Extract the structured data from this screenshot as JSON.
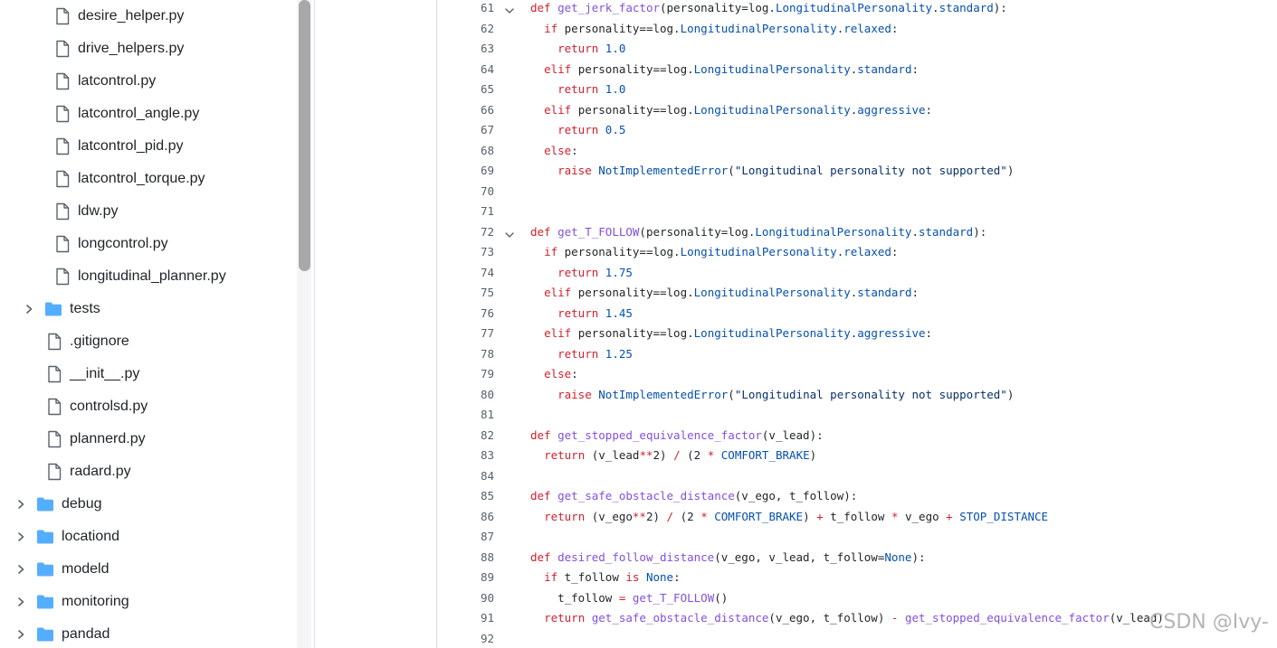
{
  "file_tree": {
    "items": [
      {
        "type": "file",
        "name": "desire_helper.py",
        "indent": 2
      },
      {
        "type": "file",
        "name": "drive_helpers.py",
        "indent": 2
      },
      {
        "type": "file",
        "name": "latcontrol.py",
        "indent": 2
      },
      {
        "type": "file",
        "name": "latcontrol_angle.py",
        "indent": 2
      },
      {
        "type": "file",
        "name": "latcontrol_pid.py",
        "indent": 2
      },
      {
        "type": "file",
        "name": "latcontrol_torque.py",
        "indent": 2
      },
      {
        "type": "file",
        "name": "ldw.py",
        "indent": 2
      },
      {
        "type": "file",
        "name": "longcontrol.py",
        "indent": 2
      },
      {
        "type": "file",
        "name": "longitudinal_planner.py",
        "indent": 2
      },
      {
        "type": "folder",
        "name": "tests",
        "indent": 1
      },
      {
        "type": "file",
        "name": ".gitignore",
        "indent": 1
      },
      {
        "type": "file",
        "name": "__init__.py",
        "indent": 1
      },
      {
        "type": "file",
        "name": "controlsd.py",
        "indent": 1
      },
      {
        "type": "file",
        "name": "plannerd.py",
        "indent": 1
      },
      {
        "type": "file",
        "name": "radard.py",
        "indent": 1
      },
      {
        "type": "folder",
        "name": "debug",
        "indent": 0
      },
      {
        "type": "folder",
        "name": "locationd",
        "indent": 0
      },
      {
        "type": "folder",
        "name": "modeld",
        "indent": 0
      },
      {
        "type": "folder",
        "name": "monitoring",
        "indent": 0
      },
      {
        "type": "folder",
        "name": "pandad",
        "indent": 0
      }
    ]
  },
  "code": {
    "lines": [
      {
        "n": "61",
        "fold": true,
        "tokens": [
          [
            "k",
            "def "
          ],
          [
            "f",
            "get_jerk_factor"
          ],
          [
            "p",
            "(personality=log."
          ],
          [
            "c",
            "LongitudinalPersonality"
          ],
          [
            "p",
            "."
          ],
          [
            "c",
            "standard"
          ],
          [
            "p",
            "):"
          ]
        ]
      },
      {
        "n": "62",
        "tokens": [
          [
            "p",
            "  "
          ],
          [
            "k",
            "if"
          ],
          [
            "p",
            " personality=="
          ],
          [
            "p",
            "log."
          ],
          [
            "c",
            "LongitudinalPersonality"
          ],
          [
            "p",
            "."
          ],
          [
            "c",
            "relaxed"
          ],
          [
            "p",
            ":"
          ]
        ]
      },
      {
        "n": "63",
        "tokens": [
          [
            "p",
            "    "
          ],
          [
            "k",
            "return"
          ],
          [
            "p",
            " "
          ],
          [
            "c",
            "1.0"
          ]
        ]
      },
      {
        "n": "64",
        "tokens": [
          [
            "p",
            "  "
          ],
          [
            "k",
            "elif"
          ],
          [
            "p",
            " personality=="
          ],
          [
            "p",
            "log."
          ],
          [
            "c",
            "LongitudinalPersonality"
          ],
          [
            "p",
            "."
          ],
          [
            "c",
            "standard"
          ],
          [
            "p",
            ":"
          ]
        ]
      },
      {
        "n": "65",
        "tokens": [
          [
            "p",
            "    "
          ],
          [
            "k",
            "return"
          ],
          [
            "p",
            " "
          ],
          [
            "c",
            "1.0"
          ]
        ]
      },
      {
        "n": "66",
        "tokens": [
          [
            "p",
            "  "
          ],
          [
            "k",
            "elif"
          ],
          [
            "p",
            " personality=="
          ],
          [
            "p",
            "log."
          ],
          [
            "c",
            "LongitudinalPersonality"
          ],
          [
            "p",
            "."
          ],
          [
            "c",
            "aggressive"
          ],
          [
            "p",
            ":"
          ]
        ]
      },
      {
        "n": "67",
        "tokens": [
          [
            "p",
            "    "
          ],
          [
            "k",
            "return"
          ],
          [
            "p",
            " "
          ],
          [
            "c",
            "0.5"
          ]
        ]
      },
      {
        "n": "68",
        "tokens": [
          [
            "p",
            "  "
          ],
          [
            "k",
            "else"
          ],
          [
            "p",
            ":"
          ]
        ]
      },
      {
        "n": "69",
        "tokens": [
          [
            "p",
            "    "
          ],
          [
            "k",
            "raise"
          ],
          [
            "p",
            " "
          ],
          [
            "c",
            "NotImplementedError"
          ],
          [
            "p",
            "("
          ],
          [
            "s",
            "\"Longitudinal personality not supported\""
          ],
          [
            "p",
            ")"
          ]
        ]
      },
      {
        "n": "70",
        "tokens": []
      },
      {
        "n": "71",
        "tokens": []
      },
      {
        "n": "72",
        "fold": true,
        "tokens": [
          [
            "k",
            "def "
          ],
          [
            "f",
            "get_T_FOLLOW"
          ],
          [
            "p",
            "(personality=log."
          ],
          [
            "c",
            "LongitudinalPersonality"
          ],
          [
            "p",
            "."
          ],
          [
            "c",
            "standard"
          ],
          [
            "p",
            "):"
          ]
        ]
      },
      {
        "n": "73",
        "tokens": [
          [
            "p",
            "  "
          ],
          [
            "k",
            "if"
          ],
          [
            "p",
            " personality=="
          ],
          [
            "p",
            "log."
          ],
          [
            "c",
            "LongitudinalPersonality"
          ],
          [
            "p",
            "."
          ],
          [
            "c",
            "relaxed"
          ],
          [
            "p",
            ":"
          ]
        ]
      },
      {
        "n": "74",
        "tokens": [
          [
            "p",
            "    "
          ],
          [
            "k",
            "return"
          ],
          [
            "p",
            " "
          ],
          [
            "c",
            "1.75"
          ]
        ]
      },
      {
        "n": "75",
        "tokens": [
          [
            "p",
            "  "
          ],
          [
            "k",
            "elif"
          ],
          [
            "p",
            " personality=="
          ],
          [
            "p",
            "log."
          ],
          [
            "c",
            "LongitudinalPersonality"
          ],
          [
            "p",
            "."
          ],
          [
            "c",
            "standard"
          ],
          [
            "p",
            ":"
          ]
        ]
      },
      {
        "n": "76",
        "tokens": [
          [
            "p",
            "    "
          ],
          [
            "k",
            "return"
          ],
          [
            "p",
            " "
          ],
          [
            "c",
            "1.45"
          ]
        ]
      },
      {
        "n": "77",
        "tokens": [
          [
            "p",
            "  "
          ],
          [
            "k",
            "elif"
          ],
          [
            "p",
            " personality=="
          ],
          [
            "p",
            "log."
          ],
          [
            "c",
            "LongitudinalPersonality"
          ],
          [
            "p",
            "."
          ],
          [
            "c",
            "aggressive"
          ],
          [
            "p",
            ":"
          ]
        ]
      },
      {
        "n": "78",
        "tokens": [
          [
            "p",
            "    "
          ],
          [
            "k",
            "return"
          ],
          [
            "p",
            " "
          ],
          [
            "c",
            "1.25"
          ]
        ]
      },
      {
        "n": "79",
        "tokens": [
          [
            "p",
            "  "
          ],
          [
            "k",
            "else"
          ],
          [
            "p",
            ":"
          ]
        ]
      },
      {
        "n": "80",
        "tokens": [
          [
            "p",
            "    "
          ],
          [
            "k",
            "raise"
          ],
          [
            "p",
            " "
          ],
          [
            "c",
            "NotImplementedError"
          ],
          [
            "p",
            "("
          ],
          [
            "s",
            "\"Longitudinal personality not supported\""
          ],
          [
            "p",
            ")"
          ]
        ]
      },
      {
        "n": "81",
        "tokens": []
      },
      {
        "n": "82",
        "tokens": [
          [
            "k",
            "def "
          ],
          [
            "f",
            "get_stopped_equivalence_factor"
          ],
          [
            "p",
            "(v_lead):"
          ]
        ]
      },
      {
        "n": "83",
        "tokens": [
          [
            "p",
            "  "
          ],
          [
            "k",
            "return"
          ],
          [
            "p",
            " (v_lead"
          ],
          [
            "k",
            "**"
          ],
          [
            "p",
            "2) "
          ],
          [
            "k",
            "/"
          ],
          [
            "p",
            " (2 "
          ],
          [
            "k",
            "*"
          ],
          [
            "p",
            " "
          ],
          [
            "c",
            "COMFORT_BRAKE"
          ],
          [
            "p",
            ")"
          ]
        ]
      },
      {
        "n": "84",
        "tokens": []
      },
      {
        "n": "85",
        "tokens": [
          [
            "k",
            "def "
          ],
          [
            "f",
            "get_safe_obstacle_distance"
          ],
          [
            "p",
            "(v_ego, t_follow):"
          ]
        ]
      },
      {
        "n": "86",
        "tokens": [
          [
            "p",
            "  "
          ],
          [
            "k",
            "return"
          ],
          [
            "p",
            " (v_ego"
          ],
          [
            "k",
            "**"
          ],
          [
            "p",
            "2) "
          ],
          [
            "k",
            "/"
          ],
          [
            "p",
            " (2 "
          ],
          [
            "k",
            "*"
          ],
          [
            "p",
            " "
          ],
          [
            "c",
            "COMFORT_BRAKE"
          ],
          [
            "p",
            ") "
          ],
          [
            "k",
            "+"
          ],
          [
            "p",
            " t_follow "
          ],
          [
            "k",
            "*"
          ],
          [
            "p",
            " v_ego "
          ],
          [
            "k",
            "+"
          ],
          [
            "p",
            " "
          ],
          [
            "c",
            "STOP_DISTANCE"
          ]
        ]
      },
      {
        "n": "87",
        "tokens": []
      },
      {
        "n": "88",
        "tokens": [
          [
            "k",
            "def "
          ],
          [
            "f",
            "desired_follow_distance"
          ],
          [
            "p",
            "(v_ego, v_lead, t_follow="
          ],
          [
            "c",
            "None"
          ],
          [
            "p",
            "):"
          ]
        ]
      },
      {
        "n": "89",
        "tokens": [
          [
            "p",
            "  "
          ],
          [
            "k",
            "if"
          ],
          [
            "p",
            " t_follow "
          ],
          [
            "k",
            "is"
          ],
          [
            "p",
            " "
          ],
          [
            "c",
            "None"
          ],
          [
            "p",
            ":"
          ]
        ]
      },
      {
        "n": "90",
        "tokens": [
          [
            "p",
            "    t_follow "
          ],
          [
            "k",
            "="
          ],
          [
            "p",
            " "
          ],
          [
            "f",
            "get_T_FOLLOW"
          ],
          [
            "p",
            "()"
          ]
        ]
      },
      {
        "n": "91",
        "tokens": [
          [
            "p",
            "  "
          ],
          [
            "k",
            "return"
          ],
          [
            "p",
            " "
          ],
          [
            "f",
            "get_safe_obstacle_distance"
          ],
          [
            "p",
            "(v_ego, t_follow) "
          ],
          [
            "k",
            "-"
          ],
          [
            "p",
            " "
          ],
          [
            "f",
            "get_stopped_equivalence_factor"
          ],
          [
            "p",
            "(v_lead)"
          ]
        ]
      },
      {
        "n": "92",
        "tokens": []
      }
    ]
  },
  "watermark": "CSDN @Ivy-",
  "colors": {
    "keyword": "#cf222e",
    "function": "#8250df",
    "constant": "#0550ae",
    "string": "#0a3069",
    "text": "#1f2328",
    "line_number": "#57606a",
    "folder": "#54aeff",
    "file_icon": "#59636e"
  }
}
